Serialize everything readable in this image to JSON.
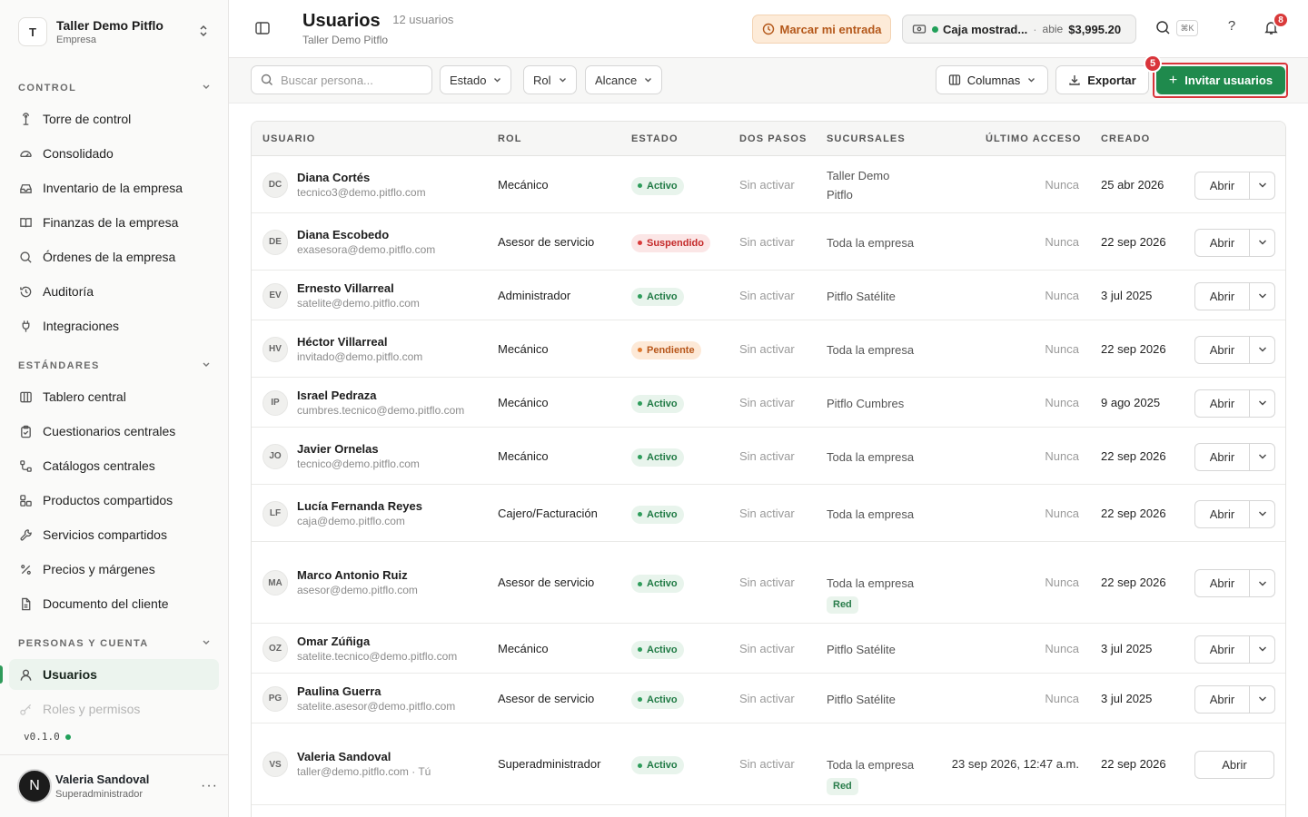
{
  "org": {
    "initial": "T",
    "name": "Taller Demo Pitflo",
    "type": "Empresa"
  },
  "sections": {
    "control": "CONTROL",
    "standards": "ESTÁNDARES",
    "people": "PERSONAS Y CUENTA"
  },
  "nav": {
    "control": [
      "Torre de control",
      "Consolidado",
      "Inventario de la empresa",
      "Finanzas de la empresa",
      "Órdenes de la empresa",
      "Auditoría",
      "Integraciones"
    ],
    "standards": [
      "Tablero central",
      "Cuestionarios centrales",
      "Catálogos centrales",
      "Productos compartidos",
      "Servicios compartidos",
      "Precios y márgenes",
      "Documento del cliente"
    ],
    "people": [
      "Usuarios",
      "Roles y permisos"
    ]
  },
  "version": "v0.1.0",
  "current_user": {
    "initial": "N",
    "name": "Valeria Sandoval",
    "role": "Superadministrador",
    "more": "···"
  },
  "header": {
    "title": "Usuarios",
    "count": "12 usuarios",
    "subtitle": "Taller Demo Pitflo",
    "checkin_label": "Marcar mi entrada",
    "cashbox": {
      "name": "Caja mostrad...",
      "sep": "·",
      "status": "abie",
      "amount": "$3,995.20"
    },
    "shortcut": "⌘K",
    "help": "?",
    "notifications": "8"
  },
  "toolbar": {
    "search_placeholder": "Buscar persona...",
    "filters": [
      "Estado",
      "Rol",
      "Alcance"
    ],
    "columns_label": "Columnas",
    "export_label": "Exportar",
    "invite_label": "Invitar usuarios",
    "invite_badge": "5"
  },
  "table": {
    "headers": {
      "user": "USUARIO",
      "role": "ROL",
      "status": "ESTADO",
      "twofa": "DOS PASOS",
      "branches": "SUCURSALES",
      "last_access": "ÚLTIMO ACCESO",
      "created": "CREADO"
    },
    "open_label": "Abrir",
    "rows": [
      {
        "initials": "DC",
        "name": "Diana Cortés",
        "email": "tecnico3@demo.pitflo.com",
        "role": "Mecánico",
        "status": "Activo",
        "twofa": "Sin activar",
        "branch": "Taller Demo Pitflo",
        "tag": "",
        "last_access": "Nunca",
        "created": "25 abr 2026"
      },
      {
        "initials": "DE",
        "name": "Diana Escobedo",
        "email": "exasesora@demo.pitflo.com",
        "role": "Asesor de servicio",
        "status": "Suspendido",
        "twofa": "Sin activar",
        "branch": "Toda la empresa",
        "tag": "",
        "last_access": "Nunca",
        "created": "22 sep 2026"
      },
      {
        "initials": "EV",
        "name": "Ernesto Villarreal",
        "email": "satelite@demo.pitflo.com",
        "role": "Administrador",
        "status": "Activo",
        "twofa": "Sin activar",
        "branch": "Pitflo Satélite",
        "tag": "",
        "last_access": "Nunca",
        "created": "3 jul 2025"
      },
      {
        "initials": "HV",
        "name": "Héctor Villarreal",
        "email": "invitado@demo.pitflo.com",
        "role": "Mecánico",
        "status": "Pendiente",
        "twofa": "Sin activar",
        "branch": "Toda la empresa",
        "tag": "",
        "last_access": "Nunca",
        "created": "22 sep 2026"
      },
      {
        "initials": "IP",
        "name": "Israel Pedraza",
        "email": "cumbres.tecnico@demo.pitflo.com",
        "role": "Mecánico",
        "status": "Activo",
        "twofa": "Sin activar",
        "branch": "Pitflo Cumbres",
        "tag": "",
        "last_access": "Nunca",
        "created": "9 ago 2025"
      },
      {
        "initials": "JO",
        "name": "Javier Ornelas",
        "email": "tecnico@demo.pitflo.com",
        "role": "Mecánico",
        "status": "Activo",
        "twofa": "Sin activar",
        "branch": "Toda la empresa",
        "tag": "",
        "last_access": "Nunca",
        "created": "22 sep 2026"
      },
      {
        "initials": "LF",
        "name": "Lucía Fernanda Reyes",
        "email": "caja@demo.pitflo.com",
        "role": "Cajero/Facturación",
        "status": "Activo",
        "twofa": "Sin activar",
        "branch": "Toda la empresa",
        "tag": "",
        "last_access": "Nunca",
        "created": "22 sep 2026"
      },
      {
        "initials": "MA",
        "name": "Marco Antonio Ruiz",
        "email": "asesor@demo.pitflo.com",
        "role": "Asesor de servicio",
        "status": "Activo",
        "twofa": "Sin activar",
        "branch": "Toda la empresa",
        "tag": "Red",
        "last_access": "Nunca",
        "created": "22 sep 2026"
      },
      {
        "initials": "OZ",
        "name": "Omar Zúñiga",
        "email": "satelite.tecnico@demo.pitflo.com",
        "role": "Mecánico",
        "status": "Activo",
        "twofa": "Sin activar",
        "branch": "Pitflo Satélite",
        "tag": "",
        "last_access": "Nunca",
        "created": "3 jul 2025"
      },
      {
        "initials": "PG",
        "name": "Paulina Guerra",
        "email": "satelite.asesor@demo.pitflo.com",
        "role": "Asesor de servicio",
        "status": "Activo",
        "twofa": "Sin activar",
        "branch": "Pitflo Satélite",
        "tag": "",
        "last_access": "Nunca",
        "created": "3 jul 2025"
      },
      {
        "initials": "VS",
        "name": "Valeria Sandoval",
        "email": "taller@demo.pitflo.com · Tú",
        "role": "Superadministrador",
        "status": "Activo",
        "twofa": "Sin activar",
        "branch": "Toda la empresa",
        "tag": "Red",
        "last_access": "23 sep 2026, 12:47 a.m.",
        "created": "22 sep 2026"
      }
    ]
  }
}
